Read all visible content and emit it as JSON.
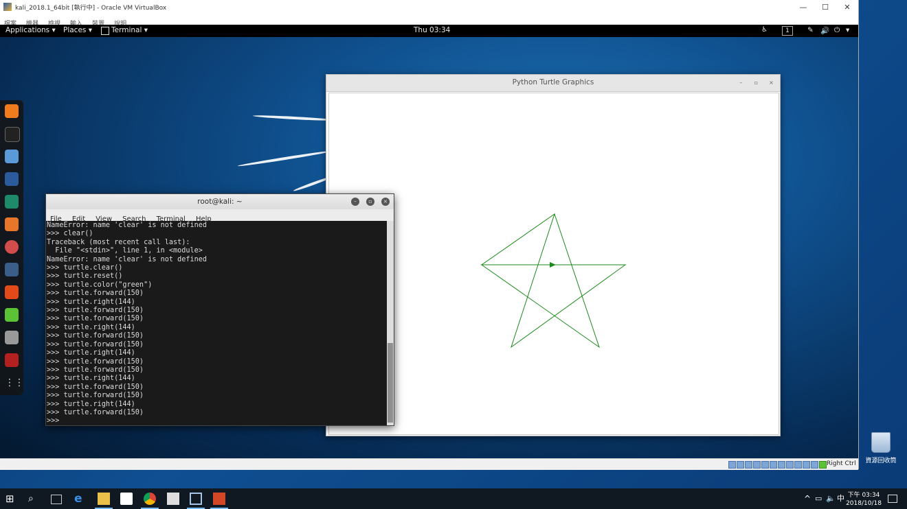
{
  "host": {
    "title": "kali_2018.1_64bit [執行中] - Oracle VM VirtualBox",
    "menu": [
      "檔案",
      "機器",
      "檢視",
      "輸入",
      "裝置",
      "說明"
    ],
    "window_controls": [
      "—",
      "☐",
      "✕"
    ],
    "status_host_key": "Right Ctrl"
  },
  "gnome": {
    "applications": "Applications ▾",
    "places": "Places ▾",
    "terminal": "Terminal ▾",
    "clock": "Thu 03:34",
    "workspace": "1"
  },
  "turtle_window": {
    "title": "Python Turtle Graphics",
    "pen_color": "#1a8a1a",
    "drawing_icon": "star-shape"
  },
  "terminal": {
    "title": "root@kali: ~",
    "menu": [
      "File",
      "Edit",
      "View",
      "Search",
      "Terminal",
      "Help"
    ],
    "lines": [
      "NameError: name 'clear' is not defined",
      ">>> clear()",
      "Traceback (most recent call last):",
      "  File \"<stdin>\", line 1, in <module>",
      "NameError: name 'clear' is not defined",
      ">>> turtle.clear()",
      ">>> turtle.reset()",
      ">>> turtle.color(\"green\")",
      ">>> turtle.forward(150)",
      ">>> turtle.right(144)",
      ">>> turtle.forward(150)",
      ">>> turtle.forward(150)",
      ">>> turtle.right(144)",
      ">>> turtle.forward(150)",
      ">>> turtle.forward(150)",
      ">>> turtle.right(144)",
      ">>> turtle.forward(150)",
      ">>> turtle.forward(150)",
      ">>> turtle.right(144)",
      ">>> turtle.forward(150)",
      ">>> turtle.forward(150)",
      ">>> turtle.right(144)",
      ">>> turtle.forward(150)",
      ">>> "
    ]
  },
  "desktop": {
    "recycle_bin_label": "資源回收筒"
  },
  "taskbar": {
    "clock_time": "下午 03:34",
    "clock_date": "2018/10/18",
    "ime": "中"
  },
  "colors": {
    "taskbar": "#101821",
    "terminal_bg": "#1a1a1a",
    "terminal_fg": "#dcdcdc",
    "pen": "#1a8a1a"
  }
}
